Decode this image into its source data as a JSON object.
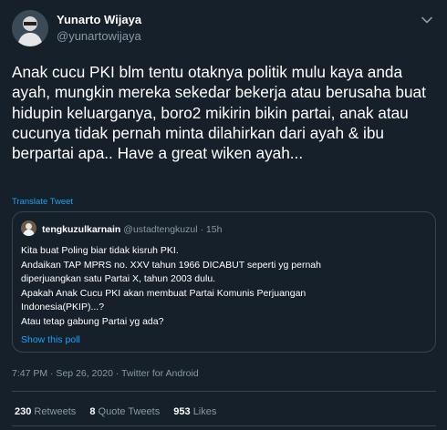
{
  "author": {
    "name": "Yunarto Wijaya",
    "handle": "@yunartowijaya"
  },
  "tweet": {
    "text": "Anak cucu PKI blm tentu otaknya politik mulu kaya anda ayah, mungkin mereka sekedar bekerja atau berusaha buat hidupin keluarganya, boro2 mikirin bikin partai, anak atau cucunya tidak pernah minta dilahirkan dari ayah & ibu berpartai apa.. Have a great wiken ayah...",
    "translate_label": "Translate Tweet"
  },
  "quoted": {
    "name": "tengkuzulkarnain",
    "handle": "@ustadtengkuzul",
    "separator": " · ",
    "time": "15h",
    "lines": [
      "Kita buat Poling biar tidak kisruh PKI.",
      "Andaikan TAP MPRS no. XXV tahun 1966 DICABUT seperti yg pernah",
      "diperjuangkan satu Partai X,  tahun 2003 dulu.",
      "Apakah Anak Cucu PKI akan membuat Partai Komunis Perjuangan",
      "Indonesia(PKIP)...?",
      "Atau tetap gabung Partai yg ada?"
    ],
    "poll_link": "Show this poll"
  },
  "meta": {
    "timestamp": "7:47 PM · Sep 26, 2020 · Twitter for Android"
  },
  "stats": {
    "retweets_count": "230",
    "retweets_label": "Retweets",
    "quotes_count": "8",
    "quotes_label": "Quote Tweets",
    "likes_count": "953",
    "likes_label": "Likes"
  },
  "colors": {
    "background": "#15202b",
    "text": "#ffffff",
    "muted": "#8899a6",
    "link": "#1da1f2",
    "border": "#38444d"
  },
  "icons": [
    "chevron-down-icon"
  ]
}
